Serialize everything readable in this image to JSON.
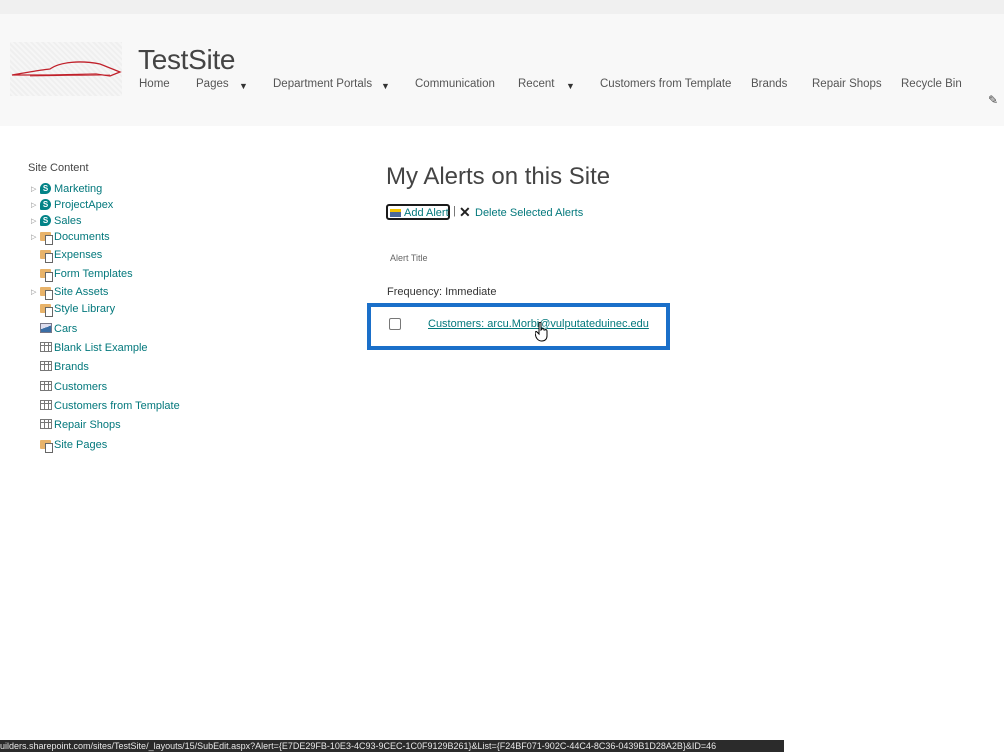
{
  "header": {
    "site_title": "TestSite",
    "nav": [
      {
        "label": "Home",
        "has_dropdown": false
      },
      {
        "label": "Pages",
        "has_dropdown": true
      },
      {
        "label": "Department Portals",
        "has_dropdown": true
      },
      {
        "label": "Communication",
        "has_dropdown": false
      },
      {
        "label": "Recent",
        "has_dropdown": true
      },
      {
        "label": "Customers from Template",
        "has_dropdown": false
      },
      {
        "label": "Brands",
        "has_dropdown": false
      },
      {
        "label": "Repair Shops",
        "has_dropdown": false
      },
      {
        "label": "Recycle Bin",
        "has_dropdown": false
      }
    ],
    "edit_icon": "pencil-icon",
    "caret_glyph": "▼"
  },
  "quick_launch": {
    "heading": "Site Content",
    "items": [
      {
        "label": "Marketing",
        "icon": "subsite",
        "expandable": true
      },
      {
        "label": "ProjectApex",
        "icon": "subsite",
        "expandable": true
      },
      {
        "label": "Sales",
        "icon": "subsite",
        "expandable": true
      },
      {
        "label": "Documents",
        "icon": "library",
        "expandable": true
      },
      {
        "label": "Expenses",
        "icon": "library",
        "expandable": false
      },
      {
        "label": "Form Templates",
        "icon": "library",
        "expandable": false
      },
      {
        "label": "Site Assets",
        "icon": "library",
        "expandable": true
      },
      {
        "label": "Style Library",
        "icon": "library",
        "expandable": false
      },
      {
        "label": "Cars",
        "icon": "picture-library",
        "expandable": false
      },
      {
        "label": "Blank List Example",
        "icon": "list",
        "expandable": false
      },
      {
        "label": "Brands",
        "icon": "list",
        "expandable": false
      },
      {
        "label": "Customers",
        "icon": "list",
        "expandable": false
      },
      {
        "label": "Customers from Template",
        "icon": "list",
        "expandable": false
      },
      {
        "label": "Repair Shops",
        "icon": "list",
        "expandable": false
      },
      {
        "label": "Site Pages",
        "icon": "library",
        "expandable": false
      }
    ]
  },
  "main": {
    "title": "My Alerts on this Site",
    "toolbar": {
      "add_alert": "Add Alert",
      "separator": "|",
      "delete_selected": "Delete Selected Alerts"
    },
    "column_header": "Alert Title",
    "group_label": "Frequency: Immediate",
    "alerts": [
      {
        "title": "Customers: arcu.Morbi@vulputateduinec.edu",
        "checked": false
      }
    ]
  },
  "status_bar": {
    "url": "uilders.sharepoint.com/sites/TestSite/_layouts/15/SubEdit.aspx?Alert={E7DE29FB-10E3-4C93-9CEC-1C0F9129B261}&List={F24BF071-902C-44C4-8C36-0439B1D28A2B}&ID=46"
  },
  "colors": {
    "link": "#03787c",
    "highlight": "#1a6fc9",
    "header_bg": "#f8f8f8"
  }
}
